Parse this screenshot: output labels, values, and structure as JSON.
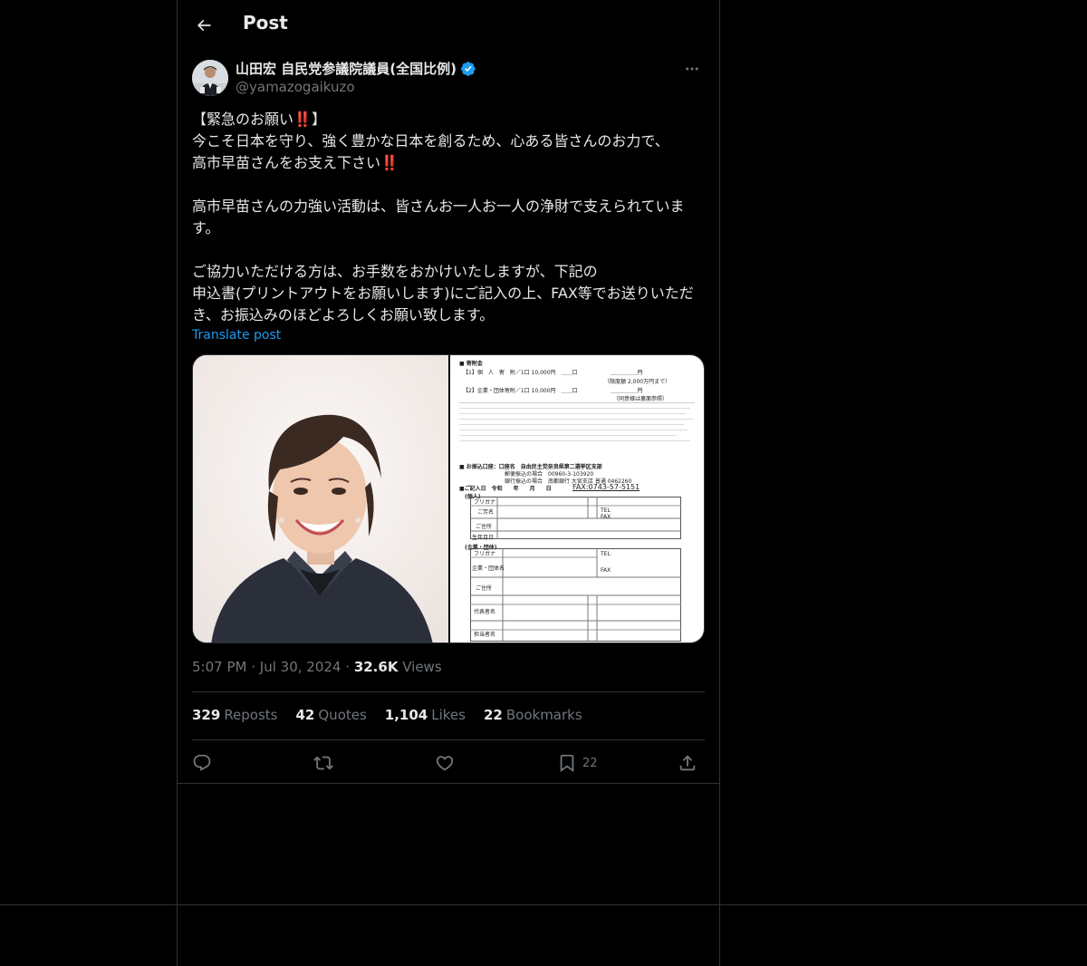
{
  "header": {
    "title": "Post"
  },
  "author": {
    "name": "山田宏 自民党参議院議員(全国比例)",
    "handle": "@yamazogaikuzo",
    "verified": true
  },
  "tweet": {
    "line1_pre": "【緊急のお願い",
    "line1_post": "】",
    "line2": "今こそ日本を守り、強く豊かな日本を創るため、心ある皆さんのお力で、",
    "line3": "高市早苗さんをお支え下さい",
    "bang": "‼️",
    "para2": "高市早苗さんの力強い活動は、皆さんお一人お一人の浄財で支えられています。",
    "para3": "ご協力いただける方は、お手数をおかけいたしますが、下記の\n申込書(プリントアウトをお願いします)にご記入の上、FAX等でお送りいただき、お振込みのほどよろしくお願い致します。"
  },
  "translate_label": "Translate post",
  "meta": {
    "time": "5:07 PM",
    "dot": "·",
    "date": "Jul 30, 2024",
    "views_count": "32.6K",
    "views_label": "Views"
  },
  "stats": {
    "reposts_count": "329",
    "reposts_label": "Reposts",
    "quotes_count": "42",
    "quotes_label": "Quotes",
    "likes_count": "1,104",
    "likes_label": "Likes",
    "bookmarks_count": "22",
    "bookmarks_label": "Bookmarks"
  },
  "actions": {
    "bookmark_count": "22"
  },
  "document": {
    "heading": "■ 寄附金",
    "row1": "【1】個　人　寄　附／1口 10,000円　＿＿口　　　　　　＿＿＿＿＿円",
    "row1_note": "（限度額 2,000万円まで）",
    "row2": "【2】企業・団体寄附／1口 10,000円　＿＿口　　　　　　＿＿＿＿＿円",
    "row2_note": "（同意様は裏面参照）",
    "account_title": "■ お振込口座：口座名　自由民主党奈良県第二選挙区支部",
    "postal": "郵便振込の場合　00960-3-103920",
    "bank": "銀行振込の場合　南都銀行 大宮支店 普通 0462260",
    "fax": "FAX:0743-57-5151",
    "date_label": "■ご記入日　令和　　年　　月　　日",
    "individual": "(個人)",
    "corporate": "(企業・団体)",
    "furigana": "フリガナ",
    "name_label": "ご芳名",
    "address": "ご住所",
    "birthday": "生年月日",
    "tel": "TEL",
    "fax_short": "FAX",
    "company_name": "企業・団体名",
    "rep_name": "代表者名",
    "contact_name": "担当者名"
  }
}
